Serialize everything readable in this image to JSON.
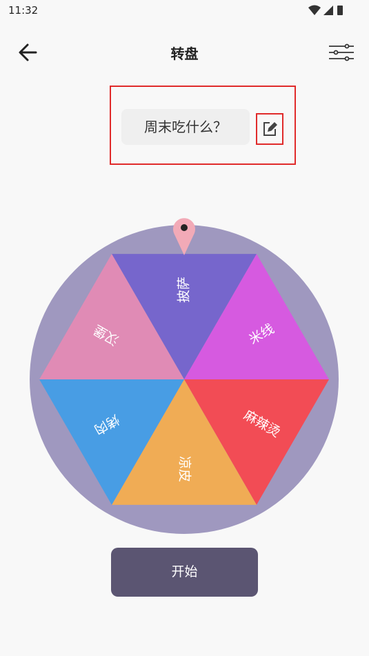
{
  "status": {
    "time": "11:32"
  },
  "header": {
    "title": "转盘"
  },
  "question": {
    "text": "周末吃什么？"
  },
  "wheel": {
    "slices": [
      {
        "label": "披萨",
        "color": "#7666cc"
      },
      {
        "label": "米线",
        "color": "#d65ae0"
      },
      {
        "label": "麻辣烫",
        "color": "#f24c55"
      },
      {
        "label": "凉皮",
        "color": "#f0ac55"
      },
      {
        "label": "烤肉",
        "color": "#489de4"
      },
      {
        "label": "汉堡",
        "color": "#e08bb5"
      }
    ],
    "rim_color": "#9f98bf",
    "pointer_color": "#f2aab7"
  },
  "start_button": {
    "label": "开始"
  }
}
